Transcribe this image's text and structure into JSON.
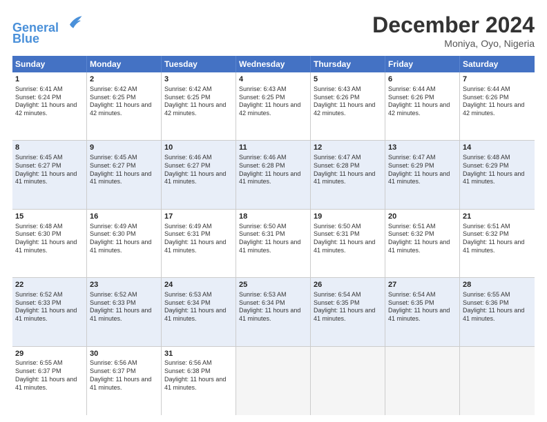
{
  "logo": {
    "line1": "General",
    "line2": "Blue"
  },
  "title": "December 2024",
  "location": "Moniya, Oyo, Nigeria",
  "days": [
    "Sunday",
    "Monday",
    "Tuesday",
    "Wednesday",
    "Thursday",
    "Friday",
    "Saturday"
  ],
  "weeks": [
    [
      {
        "day": 1,
        "rise": "6:41 AM",
        "set": "6:24 PM",
        "daylight": "11 hours and 42 minutes."
      },
      {
        "day": 2,
        "rise": "6:42 AM",
        "set": "6:25 PM",
        "daylight": "11 hours and 42 minutes."
      },
      {
        "day": 3,
        "rise": "6:42 AM",
        "set": "6:25 PM",
        "daylight": "11 hours and 42 minutes."
      },
      {
        "day": 4,
        "rise": "6:43 AM",
        "set": "6:25 PM",
        "daylight": "11 hours and 42 minutes."
      },
      {
        "day": 5,
        "rise": "6:43 AM",
        "set": "6:26 PM",
        "daylight": "11 hours and 42 minutes."
      },
      {
        "day": 6,
        "rise": "6:44 AM",
        "set": "6:26 PM",
        "daylight": "11 hours and 42 minutes."
      },
      {
        "day": 7,
        "rise": "6:44 AM",
        "set": "6:26 PM",
        "daylight": "11 hours and 42 minutes."
      }
    ],
    [
      {
        "day": 8,
        "rise": "6:45 AM",
        "set": "6:27 PM",
        "daylight": "11 hours and 41 minutes."
      },
      {
        "day": 9,
        "rise": "6:45 AM",
        "set": "6:27 PM",
        "daylight": "11 hours and 41 minutes."
      },
      {
        "day": 10,
        "rise": "6:46 AM",
        "set": "6:27 PM",
        "daylight": "11 hours and 41 minutes."
      },
      {
        "day": 11,
        "rise": "6:46 AM",
        "set": "6:28 PM",
        "daylight": "11 hours and 41 minutes."
      },
      {
        "day": 12,
        "rise": "6:47 AM",
        "set": "6:28 PM",
        "daylight": "11 hours and 41 minutes."
      },
      {
        "day": 13,
        "rise": "6:47 AM",
        "set": "6:29 PM",
        "daylight": "11 hours and 41 minutes."
      },
      {
        "day": 14,
        "rise": "6:48 AM",
        "set": "6:29 PM",
        "daylight": "11 hours and 41 minutes."
      }
    ],
    [
      {
        "day": 15,
        "rise": "6:48 AM",
        "set": "6:30 PM",
        "daylight": "11 hours and 41 minutes."
      },
      {
        "day": 16,
        "rise": "6:49 AM",
        "set": "6:30 PM",
        "daylight": "11 hours and 41 minutes."
      },
      {
        "day": 17,
        "rise": "6:49 AM",
        "set": "6:31 PM",
        "daylight": "11 hours and 41 minutes."
      },
      {
        "day": 18,
        "rise": "6:50 AM",
        "set": "6:31 PM",
        "daylight": "11 hours and 41 minutes."
      },
      {
        "day": 19,
        "rise": "6:50 AM",
        "set": "6:31 PM",
        "daylight": "11 hours and 41 minutes."
      },
      {
        "day": 20,
        "rise": "6:51 AM",
        "set": "6:32 PM",
        "daylight": "11 hours and 41 minutes."
      },
      {
        "day": 21,
        "rise": "6:51 AM",
        "set": "6:32 PM",
        "daylight": "11 hours and 41 minutes."
      }
    ],
    [
      {
        "day": 22,
        "rise": "6:52 AM",
        "set": "6:33 PM",
        "daylight": "11 hours and 41 minutes."
      },
      {
        "day": 23,
        "rise": "6:52 AM",
        "set": "6:33 PM",
        "daylight": "11 hours and 41 minutes."
      },
      {
        "day": 24,
        "rise": "6:53 AM",
        "set": "6:34 PM",
        "daylight": "11 hours and 41 minutes."
      },
      {
        "day": 25,
        "rise": "6:53 AM",
        "set": "6:34 PM",
        "daylight": "11 hours and 41 minutes."
      },
      {
        "day": 26,
        "rise": "6:54 AM",
        "set": "6:35 PM",
        "daylight": "11 hours and 41 minutes."
      },
      {
        "day": 27,
        "rise": "6:54 AM",
        "set": "6:35 PM",
        "daylight": "11 hours and 41 minutes."
      },
      {
        "day": 28,
        "rise": "6:55 AM",
        "set": "6:36 PM",
        "daylight": "11 hours and 41 minutes."
      }
    ],
    [
      {
        "day": 29,
        "rise": "6:55 AM",
        "set": "6:37 PM",
        "daylight": "11 hours and 41 minutes."
      },
      {
        "day": 30,
        "rise": "6:56 AM",
        "set": "6:37 PM",
        "daylight": "11 hours and 41 minutes."
      },
      {
        "day": 31,
        "rise": "6:56 AM",
        "set": "6:38 PM",
        "daylight": "11 hours and 41 minutes."
      },
      null,
      null,
      null,
      null
    ]
  ],
  "row_alts": [
    false,
    true,
    false,
    true,
    false
  ]
}
